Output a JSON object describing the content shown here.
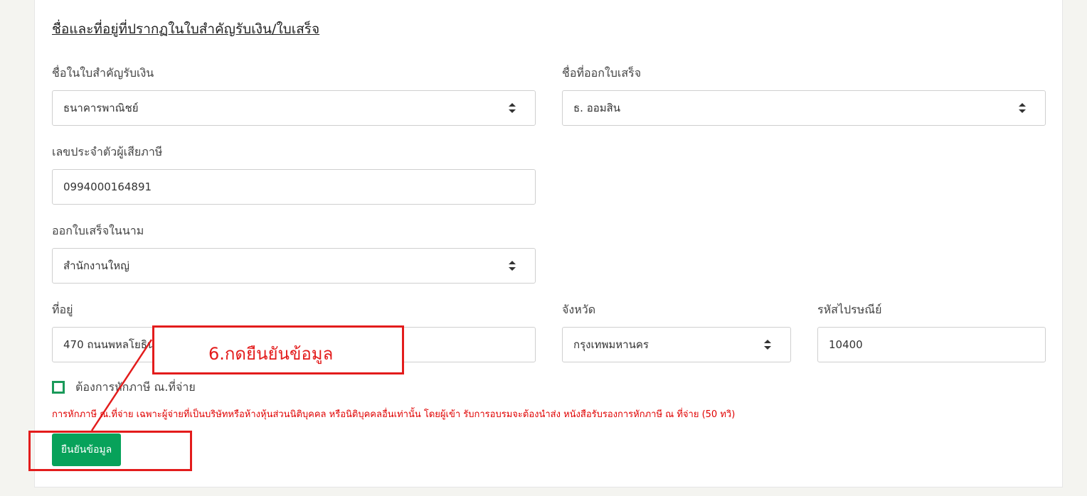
{
  "section": {
    "title": "ชื่อและที่อยู่ที่ปรากฏในใบสำคัญรับเงิน/ใบเสร็จ"
  },
  "fields": {
    "receipt_name": {
      "label": "ชื่อในใบสำคัญรับเงิน",
      "value": "ธนาคารพาณิชย์"
    },
    "invoice_issuer": {
      "label": "ชื่อที่ออกใบเสร็จ",
      "value": "ธ. ออมสิน"
    },
    "tax_id": {
      "label": "เลขประจำตัวผู้เสียภาษี",
      "value": "0994000164891"
    },
    "invoice_in_name": {
      "label": "ออกใบเสร็จในนาม",
      "value": "สำนักงานใหญ่"
    },
    "address": {
      "label": "ที่อยู่",
      "value": "470 ถนนพหลโยธิน"
    },
    "province": {
      "label": "จังหวัด",
      "value": "กรุงเทพมหานคร"
    },
    "postal_code": {
      "label": "รหัสไปรษณีย์",
      "value": "10400"
    }
  },
  "withholding": {
    "checkbox_label": "ต้องการหักภาษี ณ.ที่จ่าย",
    "checked": false,
    "warning": "การหักภาษี ณ.ที่จ่าย เฉพาะผู้จ่ายที่เป็นบริษัทหรือห้างหุ้นส่วนนิติบุคคล หรือนิติบุคคลอื่นเท่านั้น โดยผู้เข้า รับการอบรมจะต้องนำส่ง หนังสือรับรองการหักภาษี ณ ที่จ่าย (50 ทวิ)"
  },
  "actions": {
    "confirm_label": "ยืนยันข้อมูล"
  },
  "annotation": {
    "callout_text": "6.กดยืนยันข้อมูล"
  },
  "colors": {
    "accent_green": "#07a25a",
    "warning_red": "#e00000",
    "annotation_red": "#e31c1c"
  }
}
